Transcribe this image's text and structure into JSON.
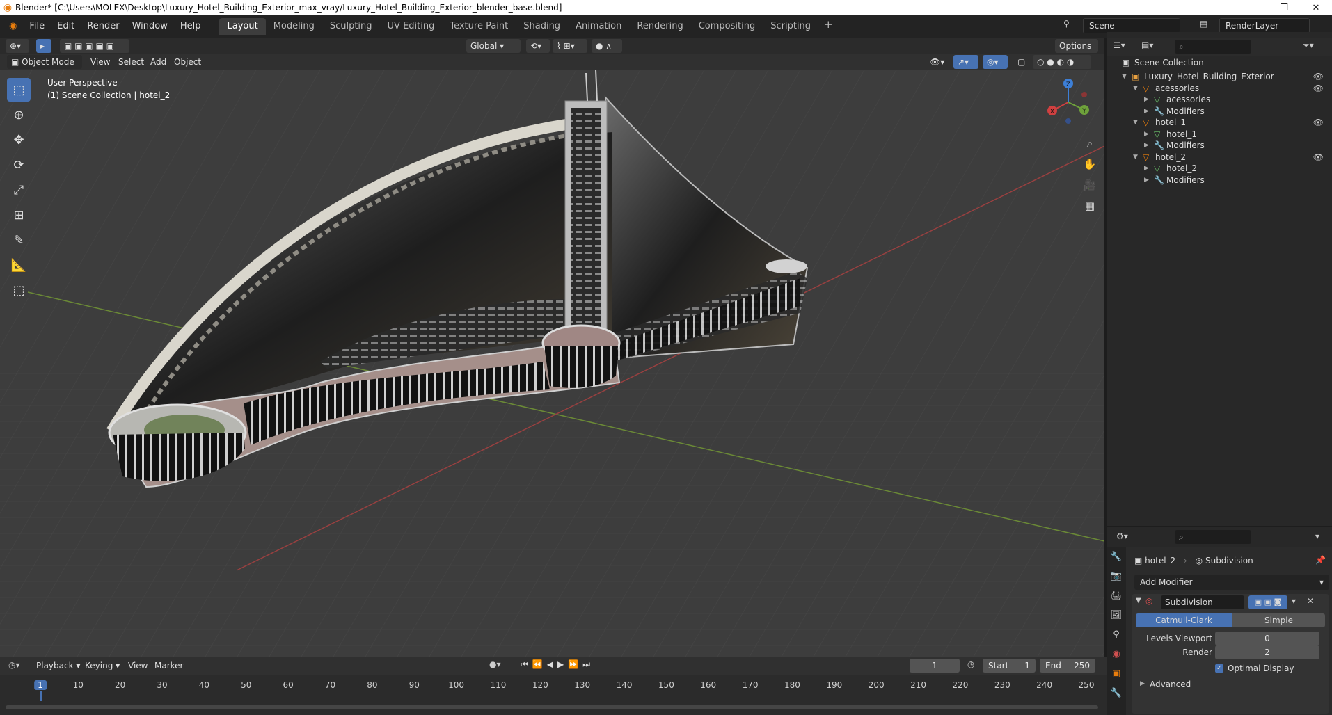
{
  "window": {
    "title": "Blender* [C:\\Users\\MOLEX\\Desktop\\Luxury_Hotel_Building_Exterior_max_vray/Luxury_Hotel_Building_Exterior_blender_base.blend]",
    "minimize": "—",
    "maximize": "❐",
    "close": "✕"
  },
  "menu": [
    "File",
    "Edit",
    "Render",
    "Window",
    "Help"
  ],
  "workspaces": [
    "Layout",
    "Modeling",
    "Sculpting",
    "UV Editing",
    "Texture Paint",
    "Shading",
    "Animation",
    "Rendering",
    "Compositing",
    "Scripting"
  ],
  "workspace_active": "Layout",
  "scene": {
    "name": "Scene",
    "render_layer": "RenderLayer"
  },
  "viewport_header": {
    "transform_orientation": "Global",
    "options": "Options",
    "mode": "Object Mode",
    "menus": [
      "View",
      "Select",
      "Add",
      "Object"
    ]
  },
  "viewport": {
    "perspective": "User Perspective",
    "collection_info": "(1) Scene Collection | hotel_2",
    "gizmo_axes": {
      "z": "Z",
      "x": "X",
      "y": "Y"
    }
  },
  "outliner": {
    "root": "Scene Collection",
    "rows": [
      {
        "label": "Luxury_Hotel_Building_Exterior",
        "indent": 1,
        "icon": "collection-icon",
        "expanded": true,
        "eye": true
      },
      {
        "label": "acessories",
        "indent": 2,
        "icon": "object-icon",
        "expanded": true,
        "eye": true
      },
      {
        "label": "acessories",
        "indent": 3,
        "icon": "mesh-icon",
        "expanded": false,
        "eye": false
      },
      {
        "label": "Modifiers",
        "indent": 3,
        "icon": "wrench-icon",
        "expanded": false,
        "eye": false
      },
      {
        "label": "hotel_1",
        "indent": 2,
        "icon": "object-icon",
        "expanded": true,
        "eye": true
      },
      {
        "label": "hotel_1",
        "indent": 3,
        "icon": "mesh-icon",
        "expanded": false,
        "eye": false
      },
      {
        "label": "Modifiers",
        "indent": 3,
        "icon": "wrench-icon",
        "expanded": false,
        "eye": false
      },
      {
        "label": "hotel_2",
        "indent": 2,
        "icon": "object-icon",
        "expanded": true,
        "eye": true
      },
      {
        "label": "hotel_2",
        "indent": 3,
        "icon": "mesh-icon",
        "expanded": false,
        "eye": false
      },
      {
        "label": "Modifiers",
        "indent": 3,
        "icon": "wrench-icon",
        "expanded": false,
        "eye": false
      }
    ]
  },
  "properties": {
    "object": "hotel_2",
    "modifier_context": "Subdivision",
    "add_modifier": "Add Modifier",
    "modifier_name": "Subdivision",
    "algorithms": [
      "Catmull-Clark",
      "Simple"
    ],
    "algorithm_active": "Catmull-Clark",
    "levels_viewport_label": "Levels Viewport",
    "levels_viewport": "0",
    "render_label": "Render",
    "render_levels": "2",
    "optimal_display": "Optimal Display",
    "advanced": "Advanced"
  },
  "timeline": {
    "menus": [
      "Playback",
      "Keying",
      "View",
      "Marker"
    ],
    "current_frame": "1",
    "start_label": "Start",
    "start": "1",
    "end_label": "End",
    "end": "250",
    "ruler": [
      "1",
      "10",
      "20",
      "30",
      "40",
      "50",
      "60",
      "70",
      "80",
      "90",
      "100",
      "110",
      "120",
      "130",
      "140",
      "150",
      "160",
      "170",
      "180",
      "190",
      "200",
      "210",
      "220",
      "230",
      "240",
      "250"
    ]
  },
  "colors": {
    "accent": "#4772b3",
    "orange": "#e87d0d",
    "viewport_bg": "#3d3d3d"
  }
}
